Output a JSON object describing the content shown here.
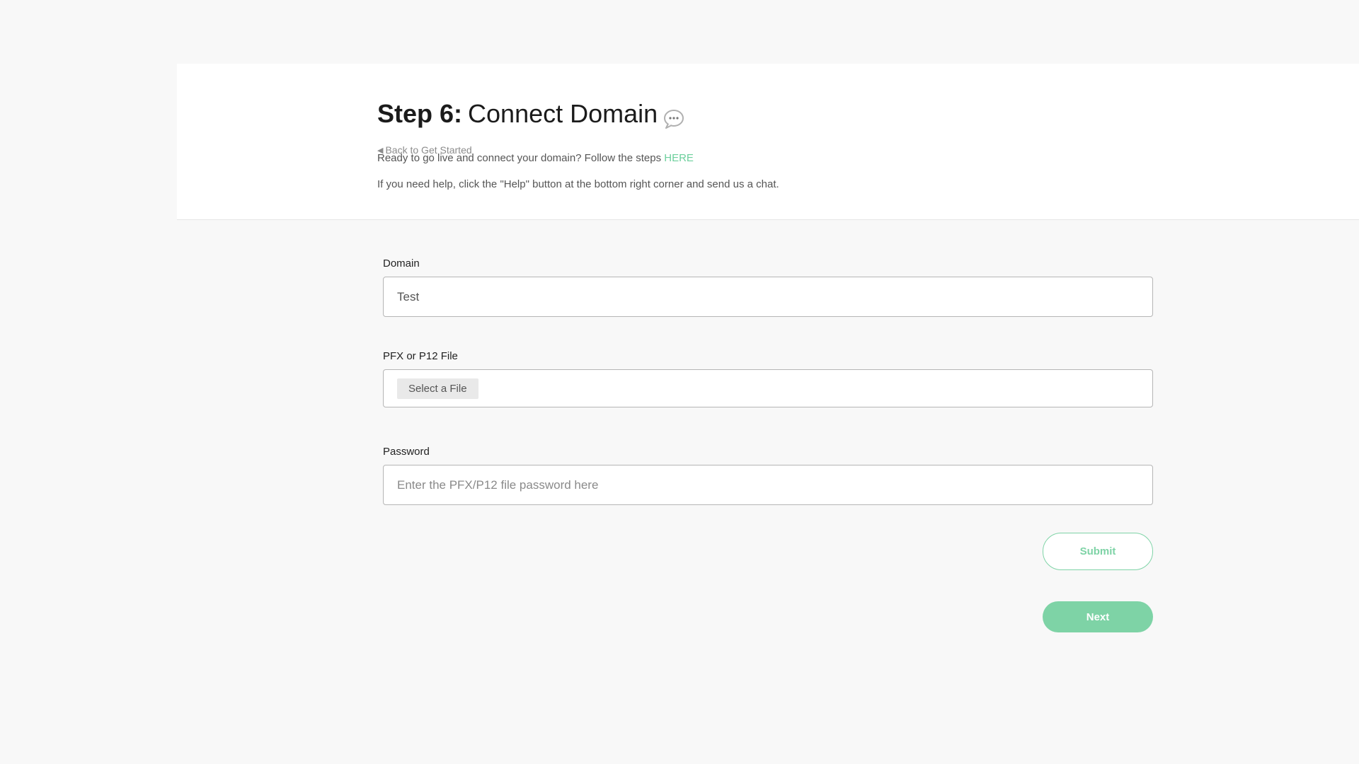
{
  "header": {
    "back_label": "Back to Get Started",
    "title_step": "Step 6:",
    "title_text": "Connect Domain",
    "intro_text": "Ready to go live and connect your domain? Follow the steps",
    "intro_link": "HERE",
    "help_text": "If you need help, click the \"Help\" button at the bottom right corner and send us a chat."
  },
  "form": {
    "domain": {
      "label": "Domain",
      "value": "Test"
    },
    "file": {
      "label": "PFX or P12 File",
      "button_label": "Select a File"
    },
    "password": {
      "label": "Password",
      "placeholder": "Enter the PFX/P12 file password here"
    },
    "submit_label": "Submit",
    "next_label": "Next"
  },
  "colors": {
    "accent": "#7ed3a6",
    "link": "#6ccf9c",
    "background": "#f8f8f8"
  },
  "icons": {
    "back": "left-triangle-icon",
    "chat": "chat-bubble-icon"
  }
}
